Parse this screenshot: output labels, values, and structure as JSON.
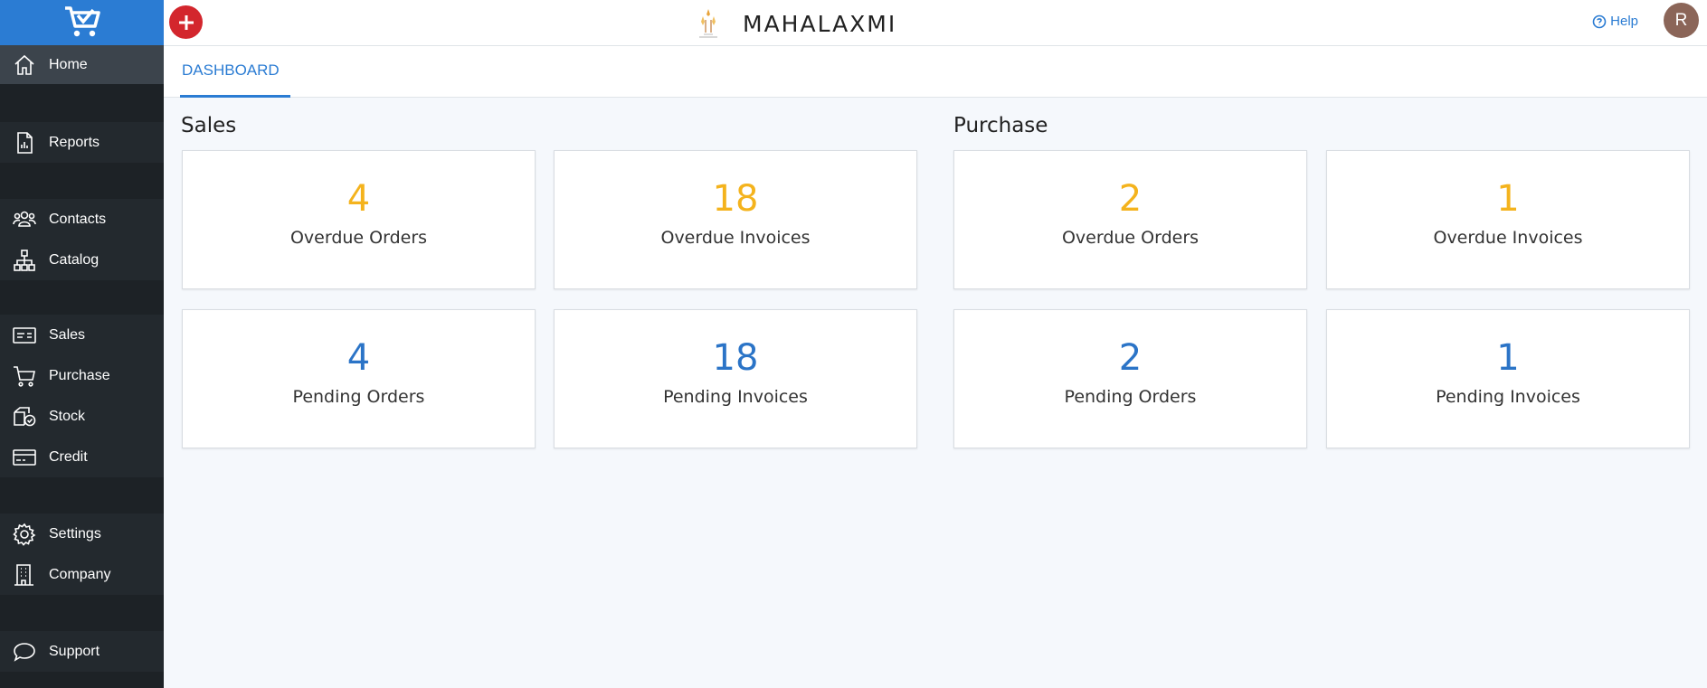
{
  "brand": {
    "name": "MAHALAXMI"
  },
  "colors": {
    "accent": "#2b7cd3",
    "add_button": "#d3262d",
    "overdue": "#f4b31d",
    "pending": "#2b74c7",
    "sidebar": "#1d2226"
  },
  "sidebar": {
    "items": [
      {
        "label": "Home",
        "icon": "home-icon"
      },
      {
        "label": "Reports",
        "icon": "report-icon"
      },
      {
        "label": "Contacts",
        "icon": "contacts-icon"
      },
      {
        "label": "Catalog",
        "icon": "catalog-icon"
      },
      {
        "label": "Sales",
        "icon": "sales-icon"
      },
      {
        "label": "Purchase",
        "icon": "cart-icon"
      },
      {
        "label": "Stock",
        "icon": "stock-icon"
      },
      {
        "label": "Credit",
        "icon": "credit-card-icon"
      },
      {
        "label": "Settings",
        "icon": "gear-icon"
      },
      {
        "label": "Company",
        "icon": "building-icon"
      },
      {
        "label": "Support",
        "icon": "chat-icon"
      }
    ]
  },
  "header": {
    "help_label": "Help",
    "avatar_initial": "R"
  },
  "tabs": [
    {
      "label": "DASHBOARD"
    }
  ],
  "dashboard": {
    "sales": {
      "title": "Sales",
      "overdue_orders": {
        "value": "4",
        "label": "Overdue Orders"
      },
      "overdue_invoices": {
        "value": "18",
        "label": "Overdue Invoices"
      },
      "pending_orders": {
        "value": "4",
        "label": "Pending Orders"
      },
      "pending_invoices": {
        "value": "18",
        "label": "Pending Invoices"
      }
    },
    "purchase": {
      "title": "Purchase",
      "overdue_orders": {
        "value": "2",
        "label": "Overdue Orders"
      },
      "overdue_invoices": {
        "value": "1",
        "label": "Overdue Invoices"
      },
      "pending_orders": {
        "value": "2",
        "label": "Pending Orders"
      },
      "pending_invoices": {
        "value": "1",
        "label": "Pending Invoices"
      }
    }
  }
}
